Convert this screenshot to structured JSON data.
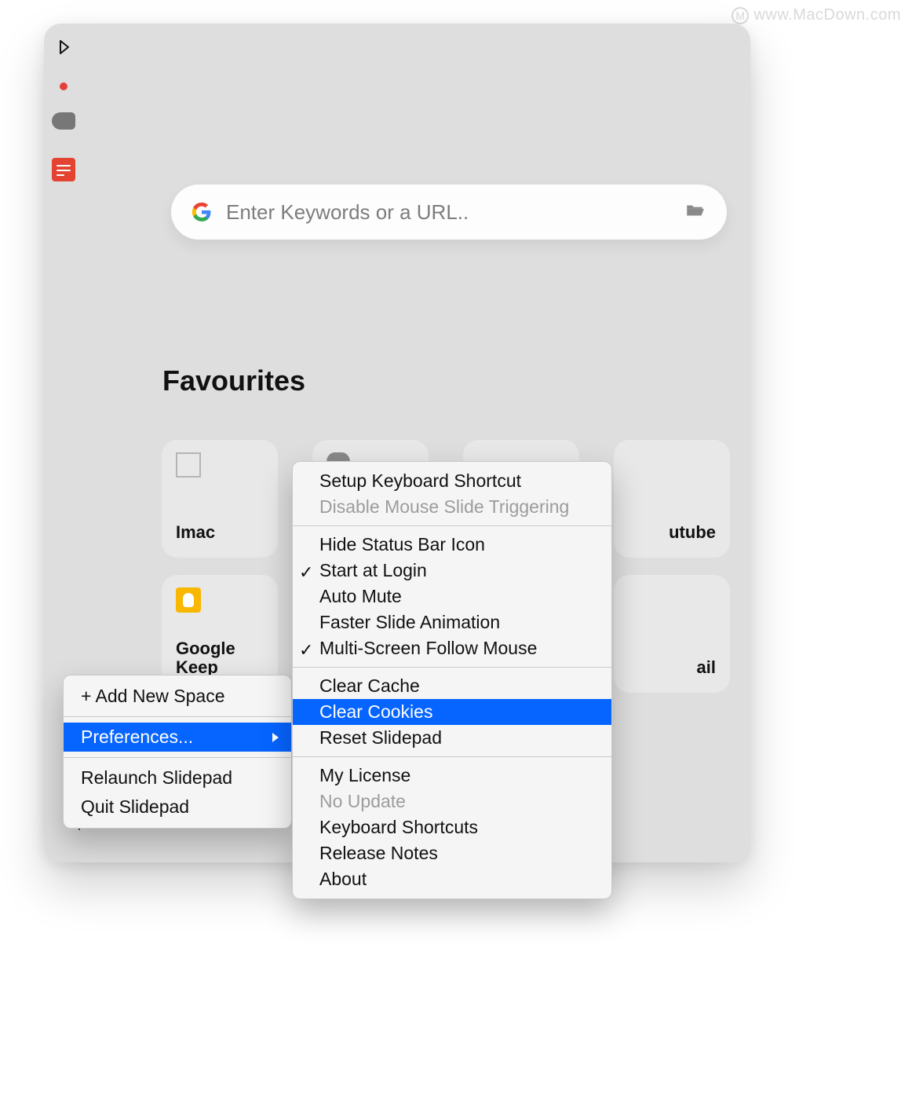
{
  "watermark": "www.MacDown.com",
  "search": {
    "placeholder": "Enter Keywords or a URL.."
  },
  "favourites_title": "Favourites",
  "favourites": [
    {
      "label": "Imac",
      "icon": "box"
    },
    {
      "label": "",
      "icon": "blob"
    },
    {
      "label": "",
      "icon": ""
    },
    {
      "label": "utube",
      "icon": ""
    },
    {
      "label": "Google\nKeep",
      "icon": "keep"
    },
    {
      "label": "",
      "icon": ""
    },
    {
      "label": "",
      "icon": ""
    },
    {
      "label": "ail",
      "icon": ""
    }
  ],
  "context_menu": {
    "items": [
      {
        "label": "+ Add New Space",
        "type": "item"
      },
      {
        "type": "sep"
      },
      {
        "label": "Preferences...",
        "type": "submenu",
        "highlight": true
      },
      {
        "type": "sep"
      },
      {
        "label": "Relaunch Slidepad",
        "type": "item"
      },
      {
        "label": "Quit Slidepad",
        "type": "item"
      }
    ]
  },
  "preferences_submenu": {
    "groups": [
      [
        {
          "label": "Setup Keyboard Shortcut"
        },
        {
          "label": "Disable Mouse Slide Triggering",
          "disabled": true
        }
      ],
      [
        {
          "label": "Hide Status Bar Icon"
        },
        {
          "label": "Start at Login",
          "checked": true
        },
        {
          "label": "Auto Mute"
        },
        {
          "label": "Faster Slide Animation"
        },
        {
          "label": "Multi-Screen Follow Mouse",
          "checked": true
        }
      ],
      [
        {
          "label": "Clear Cache"
        },
        {
          "label": "Clear Cookies",
          "highlight": true
        },
        {
          "label": "Reset Slidepad"
        }
      ],
      [
        {
          "label": "My License"
        },
        {
          "label": "No Update",
          "disabled": true
        },
        {
          "label": "Keyboard Shortcuts"
        },
        {
          "label": "Release Notes"
        },
        {
          "label": "About"
        }
      ]
    ]
  }
}
